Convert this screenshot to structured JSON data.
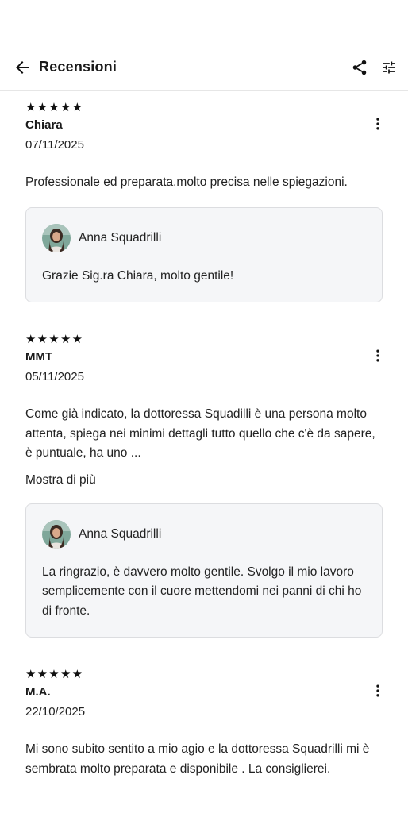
{
  "header": {
    "title": "Recensioni",
    "back_icon": "arrow-left-icon",
    "share_icon": "share-icon",
    "filter_icon": "sliders-icon"
  },
  "reviews": [
    {
      "stars": "★★★★★",
      "rating": 5,
      "author": "Chiara",
      "date": "07/11/2025",
      "text": "Professionale ed preparata.molto precisa nelle spiegazioni.",
      "reply": {
        "name": "Anna Squadrilli",
        "text": "Grazie Sig.ra Chiara, molto gentile!"
      }
    },
    {
      "stars": "★★★★★",
      "rating": 5,
      "author": "MMT",
      "date": "05/11/2025",
      "text": "Come già indicato, la dottoressa Squadilli è una persona molto attenta, spiega nei minimi dettagli tutto quello che c'è da sapere, è puntuale, ha uno ...",
      "show_more": "Mostra di più",
      "reply": {
        "name": "Anna Squadrilli",
        "text": "La ringrazio, è davvero molto gentile. Svolgo il mio lavoro semplicemente con il cuore mettendomi nei panni di chi ho di fronte."
      }
    },
    {
      "stars": "★★★★★",
      "rating": 5,
      "author": "M.A.",
      "date": "22/10/2025",
      "text": "Mi sono subito sentito a mio agio e la dottoressa Squadrilli mi è sembrata molto preparata e disponibile . La consiglierei."
    }
  ]
}
